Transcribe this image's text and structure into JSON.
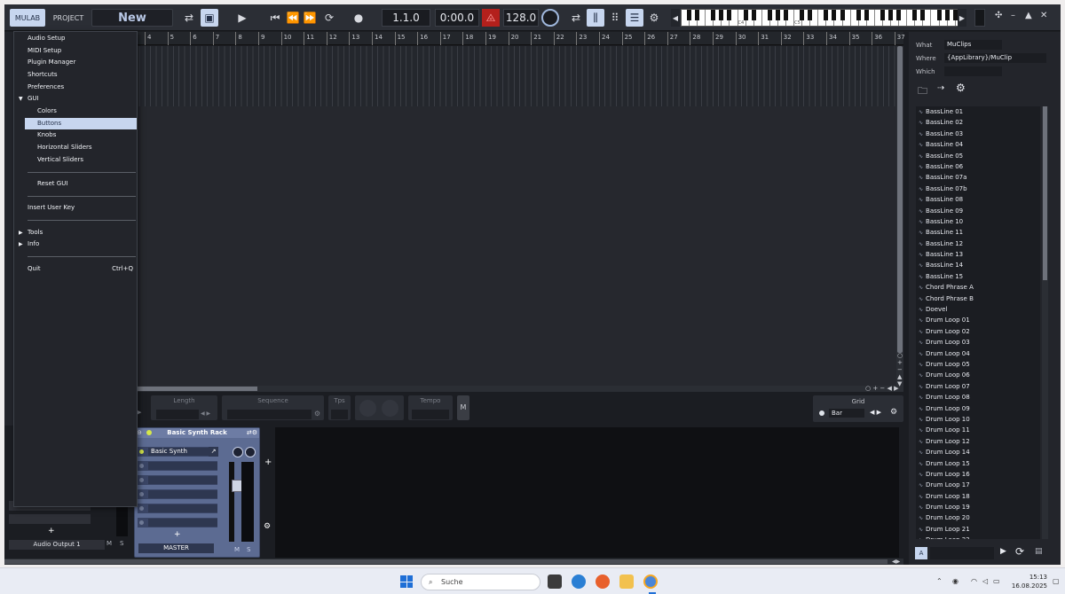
{
  "toolbar": {
    "mulab_label": "MULAB",
    "project_label": "PROJECT",
    "project_name": "New",
    "position": "1.1.0",
    "time": "0:00.0",
    "tempo": "128.0",
    "keyboard_labels": [
      "C4",
      "C5"
    ]
  },
  "menu": {
    "items": {
      "audio_setup": "Audio Setup",
      "midi_setup": "MIDI Setup",
      "plugin_manager": "Plugin Manager",
      "shortcuts": "Shortcuts",
      "preferences": "Preferences",
      "gui": "GUI",
      "colors": "Colors",
      "buttons": "Buttons",
      "knobs": "Knobs",
      "horizontal_sliders": "Horizontal Sliders",
      "vertical_sliders": "Vertical Sliders",
      "reset_gui": "Reset GUI",
      "insert_user_key": "Insert User Key",
      "tools": "Tools",
      "info": "Info",
      "quit": "Quit",
      "quit_shortcut": "Ctrl+Q"
    }
  },
  "ruler": [
    "4",
    "5",
    "6",
    "7",
    "8",
    "9",
    "10",
    "11",
    "12",
    "13",
    "14",
    "15",
    "16",
    "17",
    "18",
    "19",
    "20",
    "21",
    "22",
    "23",
    "24",
    "25",
    "26",
    "27",
    "28",
    "29",
    "30",
    "31",
    "32",
    "33",
    "34",
    "35",
    "36",
    "37"
  ],
  "editbar": {
    "length_label": "Length",
    "sequence_label": "Sequence",
    "tps_label": "Tps",
    "tempo_label": "Tempo",
    "m_label": "M",
    "grid_label": "Grid",
    "grid_value": "Bar"
  },
  "mixer": {
    "audio_output": "Audio Output 1",
    "rack_title": "Basic Synth Rack",
    "synth_name": "Basic Synth",
    "master_label": "MASTER",
    "m_label": "M",
    "s_label": "S",
    "add": "+"
  },
  "browser": {
    "what_label": "What",
    "what_value": "MuClips",
    "where_label": "Where",
    "where_value": "{AppLibrary}/MuClip",
    "which_label": "Which",
    "which_value": "",
    "clips": [
      "BassLine 01",
      "BassLine 02",
      "BassLine 03",
      "BassLine 04",
      "BassLine 05",
      "BassLine 06",
      "BassLine 07a",
      "BassLine 07b",
      "BassLine 08",
      "BassLine 09",
      "BassLine 10",
      "BassLine 11",
      "BassLine 12",
      "BassLine 13",
      "BassLine 14",
      "BassLine 15",
      "Chord Phrase A",
      "Chord Phrase B",
      "Doevel",
      "Drum Loop 01",
      "Drum Loop 02",
      "Drum Loop 03",
      "Drum Loop 04",
      "Drum Loop 05",
      "Drum Loop 06",
      "Drum Loop 07",
      "Drum Loop 08",
      "Drum Loop 09",
      "Drum Loop 10",
      "Drum Loop 11",
      "Drum Loop 12",
      "Drum Loop 14",
      "Drum Loop 15",
      "Drum Loop 16",
      "Drum Loop 17",
      "Drum Loop 18",
      "Drum Loop 19",
      "Drum Loop 20",
      "Drum Loop 21",
      "Drum Loop 22"
    ],
    "bottom_a": "A"
  },
  "taskbar": {
    "search_placeholder": "Suche",
    "time": "15:13",
    "date": "16.08.2025"
  }
}
